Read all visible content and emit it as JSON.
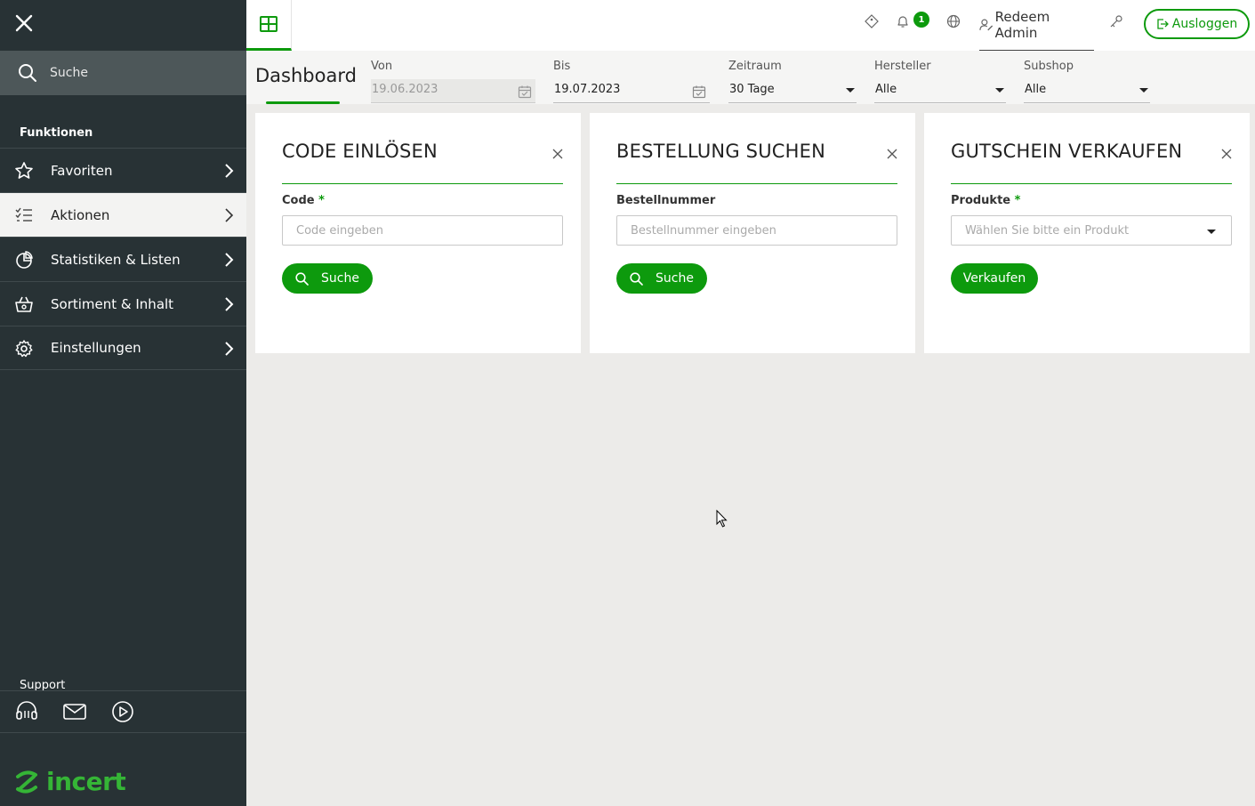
{
  "sidebar": {
    "search_placeholder": "Suche",
    "section_functions": "Funktionen",
    "items": [
      {
        "label": "Favoriten",
        "icon": "star-icon"
      },
      {
        "label": "Aktionen",
        "icon": "checklist-icon",
        "active": true
      },
      {
        "label": "Statistiken & Listen",
        "icon": "pie-chart-icon"
      },
      {
        "label": "Sortiment & Inhalt",
        "icon": "shopping-basket-icon"
      },
      {
        "label": "Einstellungen",
        "icon": "gear-icon"
      }
    ],
    "section_support": "Support",
    "support_icons": [
      "headset-icon",
      "mail-icon",
      "play-icon"
    ],
    "logo_text": "incert"
  },
  "topbar": {
    "notification_count": "1",
    "user_name": "Redeem Admin",
    "logout_label": "Ausloggen"
  },
  "filters": {
    "title": "Dashboard",
    "von": {
      "label": "Von",
      "value": "19.06.2023"
    },
    "bis": {
      "label": "Bis",
      "value": "19.07.2023"
    },
    "zeitraum": {
      "label": "Zeitraum",
      "value": "30 Tage"
    },
    "hersteller": {
      "label": "Hersteller",
      "value": "Alle"
    },
    "subshop": {
      "label": "Subshop",
      "value": "Alle"
    }
  },
  "cards": [
    {
      "title": "CODE EINLÖSEN",
      "field_label": "Code",
      "required": "*",
      "placeholder": "Code eingeben",
      "button": "Suche"
    },
    {
      "title": "BESTELLUNG SUCHEN",
      "field_label": "Bestellnummer",
      "placeholder": "Bestellnummer eingeben",
      "button": "Suche"
    },
    {
      "title": "GUTSCHEIN VERKAUFEN",
      "field_label": "Produkte",
      "required": "*",
      "placeholder": "Wählen Sie bitte ein Produkt",
      "button": "Verkaufen"
    }
  ],
  "colors": {
    "accent": "#0d9a0d",
    "sidebar_bg": "#283235",
    "logo": "#35b536"
  }
}
